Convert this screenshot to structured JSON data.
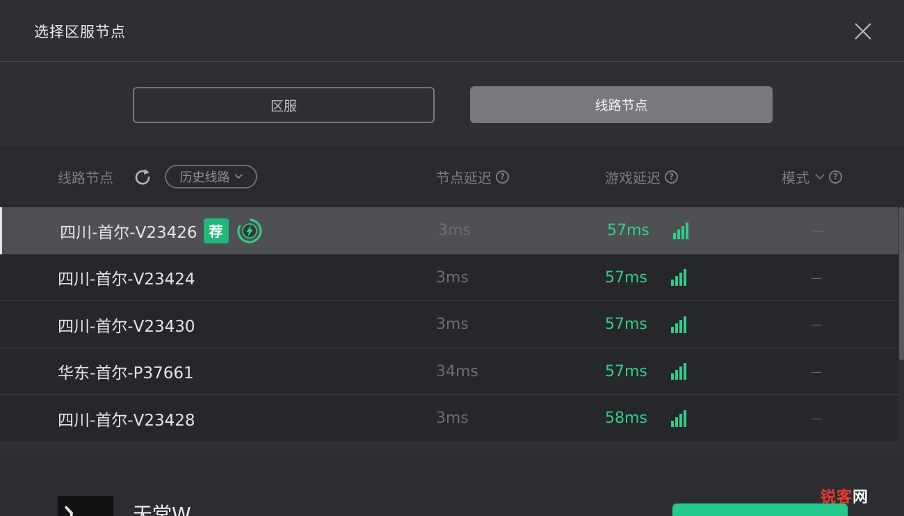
{
  "dialog": {
    "title": "选择区服节点"
  },
  "tabs": [
    {
      "label": "区服",
      "active": false
    },
    {
      "label": "线路节点",
      "active": true
    }
  ],
  "table": {
    "headers": {
      "route": "线路节点",
      "history": "历史线路",
      "node_latency": "节点延迟",
      "game_latency": "游戏延迟",
      "mode": "模式"
    },
    "rows": [
      {
        "name": "四川-首尔-V23426",
        "recommended": true,
        "recommend_label": "荐",
        "node_latency": "3ms",
        "game_latency": "57ms",
        "mode": "—"
      },
      {
        "name": "四川-首尔-V23424",
        "recommended": false,
        "node_latency": "3ms",
        "game_latency": "57ms",
        "mode": "—"
      },
      {
        "name": "四川-首尔-V23430",
        "recommended": false,
        "node_latency": "3ms",
        "game_latency": "57ms",
        "mode": "—"
      },
      {
        "name": "华东-首尔-P37661",
        "recommended": false,
        "node_latency": "34ms",
        "game_latency": "57ms",
        "mode": "—"
      },
      {
        "name": "四川-首尔-V23428",
        "recommended": false,
        "node_latency": "3ms",
        "game_latency": "58ms",
        "mode": "—"
      }
    ]
  },
  "footer": {
    "game_name": "天堂W"
  },
  "watermark": {
    "brand": "锐客",
    "suffix": "网"
  },
  "colors": {
    "accent_green": "#2fcf8a",
    "badge_green": "#1fb87a",
    "watermark_red": "#e8392b"
  }
}
